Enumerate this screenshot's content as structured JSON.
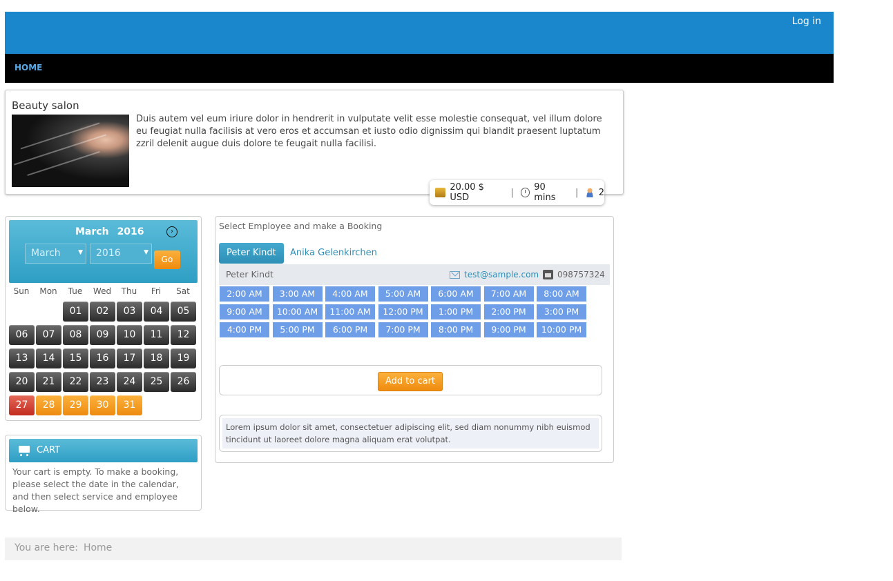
{
  "header": {
    "login_label": "Log in"
  },
  "nav": {
    "home_label": "HOME"
  },
  "service": {
    "title": "Beauty salon",
    "description": "Duis autem vel eum iriure dolor in hendrerit in vulputate velit esse molestie consequat, vel illum dolore eu feugiat nulla facilisis at vero eros et accumsan et iusto odio dignissim qui blandit praesent luptatum zzril delenit augue duis dolore te feugait nulla facilisi.",
    "price": "20.00 $ USD",
    "duration": "90 mins",
    "capacity": "2"
  },
  "calendar": {
    "month": "March",
    "year": "2016",
    "month_select": "March",
    "year_select": "2016",
    "go_label": "Go",
    "weekdays": [
      "Sun",
      "Mon",
      "Tue",
      "Wed",
      "Thu",
      "Fri",
      "Sat"
    ],
    "days": [
      [
        "",
        "",
        "01",
        "02",
        "03",
        "04",
        "05"
      ],
      [
        "06",
        "07",
        "08",
        "09",
        "10",
        "11",
        "12"
      ],
      [
        "13",
        "14",
        "15",
        "16",
        "17",
        "18",
        "19"
      ],
      [
        "20",
        "21",
        "22",
        "23",
        "24",
        "25",
        "26"
      ],
      [
        "27",
        "28",
        "29",
        "30",
        "31",
        "",
        ""
      ]
    ],
    "today": "27",
    "available": [
      "28",
      "29",
      "30",
      "31"
    ]
  },
  "cart": {
    "title": "CART",
    "empty_text": "Your cart is empty. To make a booking, please select the date in the calendar, and then select service and employee below."
  },
  "booking": {
    "title": "Select Employee and make a Booking",
    "employees": [
      "Peter Kindt",
      "Anika Gelenkirchen"
    ],
    "selected_employee": "Peter Kindt",
    "email": "test@sample.com",
    "phone": "098757324",
    "slots": [
      "2:00 AM",
      "3:00 AM",
      "4:00 AM",
      "5:00 AM",
      "6:00 AM",
      "7:00 AM",
      "8:00 AM",
      "9:00 AM",
      "10:00 AM",
      "11:00 AM",
      "12:00 PM",
      "1:00 PM",
      "2:00 PM",
      "3:00 PM",
      "4:00 PM",
      "5:00 PM",
      "6:00 PM",
      "7:00 PM",
      "8:00 PM",
      "9:00 PM",
      "10:00 PM"
    ],
    "add_to_cart_label": "Add to cart",
    "note": "Lorem ipsum dolor sit amet, consectetuer adipiscing elit, sed diam nonummy nibh euismod tincidunt ut laoreet dolore magna aliquam erat volutpat."
  },
  "breadcrumb": {
    "prefix": "You are here:",
    "home": "Home"
  },
  "colors": {
    "header_blue": "#1a87cc",
    "menu_black": "#000000",
    "accent_orange": "#ef8b0f",
    "today_red": "#c22a1e",
    "slot_blue": "#6e9ee8",
    "cal_header_blue": "#2e9fc4"
  }
}
